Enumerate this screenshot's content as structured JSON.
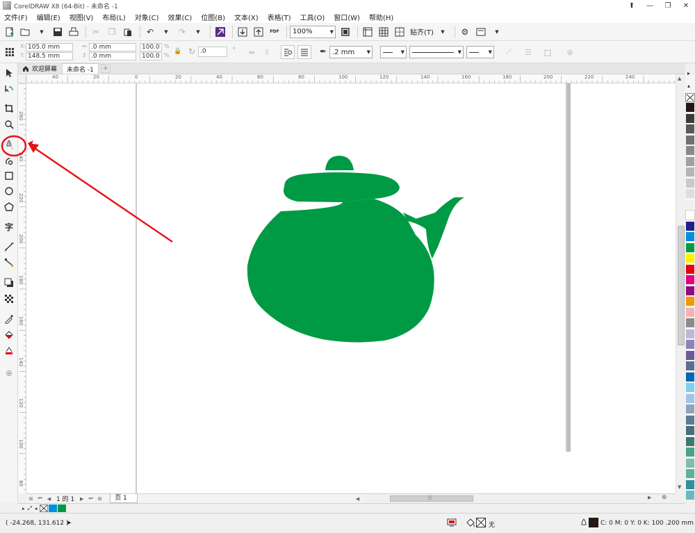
{
  "window": {
    "title": "CorelDRAW X8 (64-Bit) - 未命名 -1",
    "buttons": [
      "⬆",
      "—",
      "❐",
      "✕"
    ]
  },
  "menu": [
    "文件(F)",
    "编辑(E)",
    "视图(V)",
    "布局(L)",
    "对象(C)",
    "效果(C)",
    "位图(B)",
    "文本(X)",
    "表格(T)",
    "工具(O)",
    "窗口(W)",
    "帮助(H)"
  ],
  "toolbar": {
    "zoom_value": "100%",
    "snap_label": "贴齐(T)",
    "pdf_label": "PDF"
  },
  "property_bar": {
    "x": "105.0 mm",
    "y": "148.5 mm",
    "width": ".0 mm",
    "height": ".0 mm",
    "scale_w": "100.0",
    "scale_h": "100.0",
    "percent": "%",
    "angle": ".0",
    "outline_width": ".2 mm"
  },
  "tabs": {
    "welcome": "欢迎屏幕",
    "document": "未命名 -1",
    "add": "+"
  },
  "ruler": {
    "h_labels": [
      "40",
      "20",
      "0",
      "20",
      "40",
      "60",
      "80",
      "100",
      "120",
      "140",
      "160",
      "180",
      "200",
      "220",
      "240"
    ],
    "v_labels": [
      "260",
      "240",
      "220",
      "200",
      "180",
      "160",
      "140",
      "120",
      "100",
      "80",
      "60"
    ]
  },
  "page_nav": {
    "counter": "1 的 1",
    "page_tab": "页 1"
  },
  "status": {
    "coords": "( -24.268, 131.612 )",
    "fill_none": "无",
    "outline_info": "C: 0 M: 0 Y: 0 K: 100 .200 mm"
  },
  "colors": {
    "teapot": "#009a45",
    "annotation": "#e8141b",
    "outline_swatch": "#231815"
  },
  "palette": [
    "#231815",
    "#3e3a39",
    "#595757",
    "#727171",
    "#898989",
    "#9fa0a0",
    "#b5b5b6",
    "#c9caca",
    "#dcdddd",
    "#efefef",
    "#ffffff",
    "#1d2088",
    "#0090d9",
    "#009a45",
    "#fff100",
    "#e60012",
    "#e4007f",
    "#920783",
    "#f39800",
    "#f5b2b2",
    "#8c8c8c",
    "#c0b7d8",
    "#8f82bc",
    "#6a5a94",
    "#5b6e8f",
    "#0068b7",
    "#7ecef4",
    "#a0c5e5",
    "#8ba5c2",
    "#5f7a94",
    "#4a6d7c",
    "#3a7a6c",
    "#4aa08a",
    "#7fbfa8",
    "#5eb1a0",
    "#2f8f9d",
    "#6fb6c4"
  ],
  "doc_palette": [
    "#0090d9",
    "#009a45"
  ]
}
